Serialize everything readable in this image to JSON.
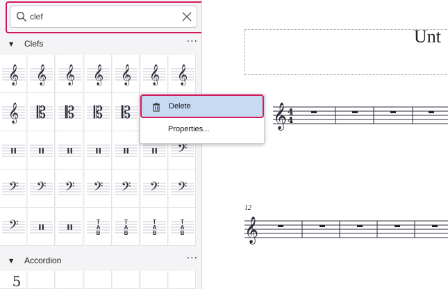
{
  "search": {
    "value": "clef",
    "placeholder": ""
  },
  "sections": [
    {
      "title": "Clefs"
    },
    {
      "title": "Accordion"
    }
  ],
  "more_label": "···",
  "context_menu": {
    "delete_label": "Delete",
    "properties_label": "Properties..."
  },
  "score": {
    "title": "Unt",
    "measure_number": "12"
  },
  "clef_glyphs": [
    "treble",
    "treble-8va",
    "treble-15ma",
    "treble-8vb",
    "treble-15mb",
    "treble-double",
    "treble-8vb-paren",
    "treble-plain",
    "c-clef-1",
    "c-clef-2",
    "c-clef-3",
    "c-clef-4",
    "c-clef-5",
    "c-clef-baritone",
    "percussion-1",
    "percussion-2",
    "percussion-3",
    "percussion-4",
    "percussion-5",
    "percussion-6",
    "bass-8vb",
    "bass-8va",
    "bass-15ma",
    "bass-8vb-small",
    "bass-15mb",
    "bass",
    "bass-baritone",
    "bass-outline",
    "bass-old",
    "percussion-bars",
    "percussion-box",
    "tab-large",
    "tab-small",
    "tab-serif",
    "tab-thin"
  ],
  "colors": {
    "accent": "#d4185e",
    "highlight": "#c8daf2",
    "ink": "#2a2a38"
  }
}
